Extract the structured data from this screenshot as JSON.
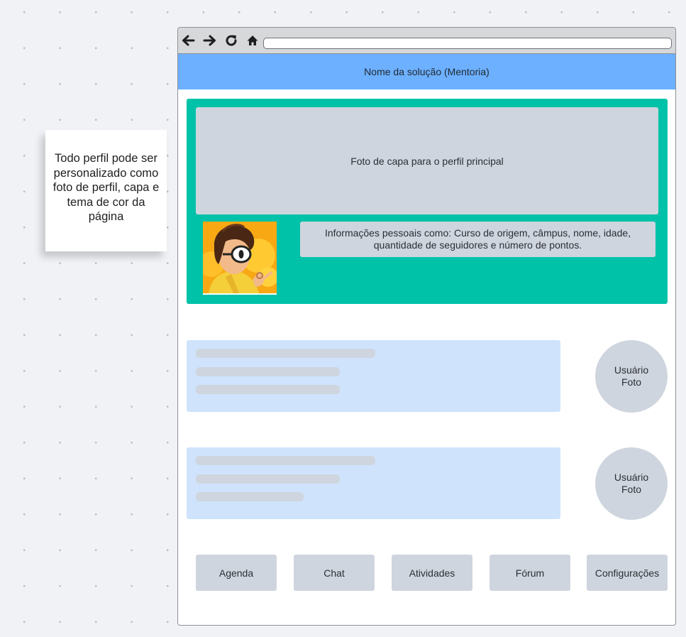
{
  "sticky_note": {
    "text": "Todo perfil pode ser personalizado como foto de perfil, capa e tema de cor da página"
  },
  "browser": {
    "toolbar_icons": [
      "back-arrow-icon",
      "forward-arrow-icon",
      "refresh-icon",
      "home-icon"
    ],
    "url": ""
  },
  "header": {
    "title": "Nome da solução (Mentoria)"
  },
  "profile": {
    "cover_label": "Foto de capa para o perfil principal",
    "info_line1": "Informações pessoais como: Curso de origem, câmpus, nome, idade,",
    "info_line2": "quantidade de seguidores e número de pontos."
  },
  "posts": [
    {
      "user_line1": "Usuário",
      "user_line2": "Foto"
    },
    {
      "user_line1": "Usuário",
      "user_line2": "Foto"
    }
  ],
  "nav": {
    "buttons": [
      "Agenda",
      "Chat",
      "Atividades",
      "Fórum",
      "Configurações"
    ]
  },
  "colors": {
    "header": "#6cb0ff",
    "profile_theme": "#00c2a8",
    "placeholder": "#cfd5de",
    "post_card": "#cfe3fc"
  }
}
